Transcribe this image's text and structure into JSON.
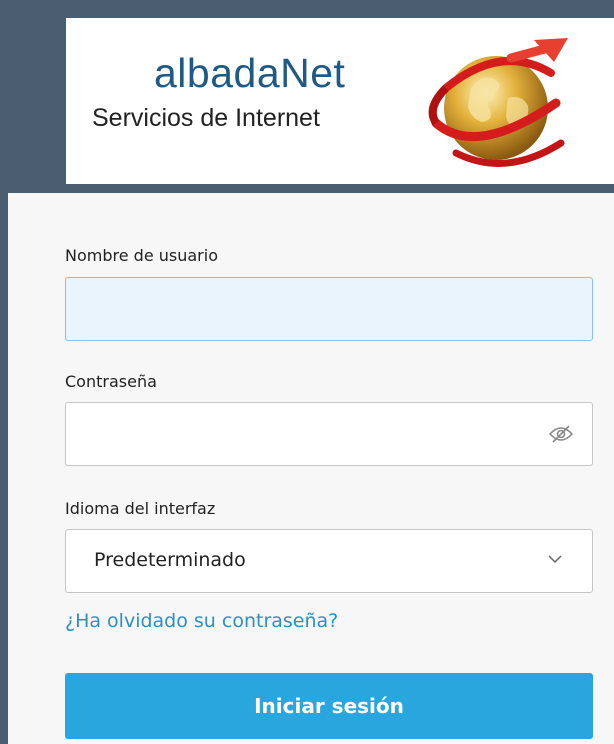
{
  "header": {
    "brand": "albadaNet",
    "tagline": "Servicios de Internet",
    "logo_icon": "globe-swirl-icon"
  },
  "form": {
    "username_label": "Nombre de usuario",
    "username_value": "",
    "password_label": "Contraseña",
    "password_value": "",
    "password_toggle_icon": "eye-slash-icon",
    "language_label": "Idioma del interfaz",
    "language_selected": "Predeterminado",
    "language_dropdown_icon": "chevron-down-icon",
    "forgot_link": "¿Ha olvidado su contraseña?",
    "login_button": "Iniciar sesión"
  },
  "colors": {
    "header_bg": "#4b5d70",
    "brand": "#1f5a86",
    "link": "#2b8fc9",
    "button": "#2aa6de"
  }
}
